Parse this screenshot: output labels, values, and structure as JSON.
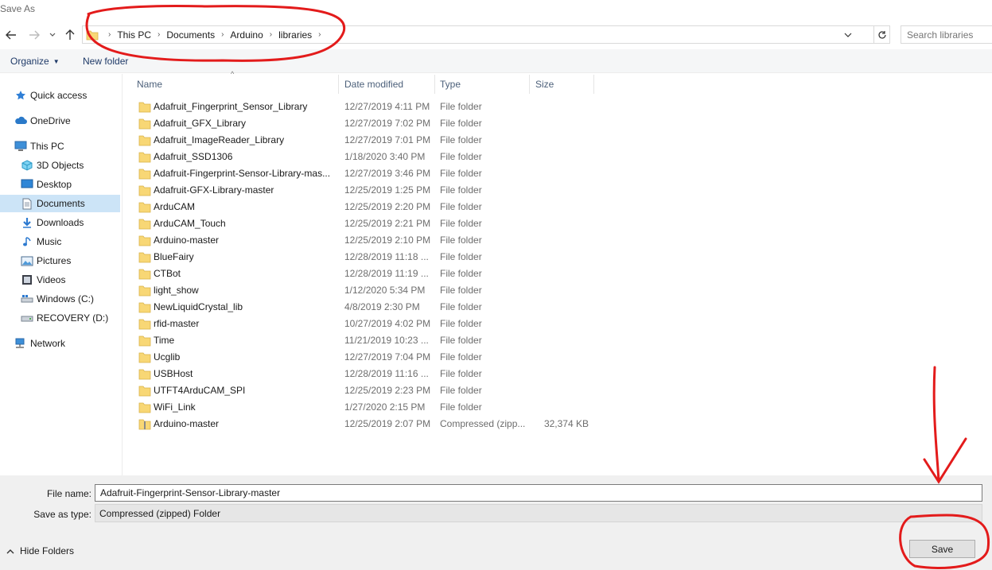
{
  "window": {
    "title": "Save As"
  },
  "address": {
    "breadcrumbs": [
      "This PC",
      "Documents",
      "Arduino",
      "libraries"
    ],
    "search_placeholder": "Search libraries"
  },
  "commands": {
    "organize": "Organize",
    "new_folder": "New folder"
  },
  "nav": {
    "items": [
      {
        "label": "Quick access",
        "icon": "star-icon"
      },
      {
        "label": "OneDrive",
        "icon": "cloud-icon"
      },
      {
        "label": "This PC",
        "icon": "computer-icon"
      },
      {
        "label": "3D Objects",
        "icon": "cube-icon"
      },
      {
        "label": "Desktop",
        "icon": "desktop-icon"
      },
      {
        "label": "Documents",
        "icon": "document-icon",
        "selected": true
      },
      {
        "label": "Downloads",
        "icon": "download-icon"
      },
      {
        "label": "Music",
        "icon": "music-icon"
      },
      {
        "label": "Pictures",
        "icon": "pictures-icon"
      },
      {
        "label": "Videos",
        "icon": "video-icon"
      },
      {
        "label": "Windows (C:)",
        "icon": "drive-icon"
      },
      {
        "label": "RECOVERY (D:)",
        "icon": "drive-icon"
      },
      {
        "label": "Network",
        "icon": "network-icon"
      }
    ]
  },
  "columns": {
    "name": "Name",
    "date": "Date modified",
    "type": "Type",
    "size": "Size"
  },
  "files": [
    {
      "name": "Adafruit_Fingerprint_Sensor_Library",
      "date": "12/27/2019 4:11 PM",
      "type": "File folder",
      "size": ""
    },
    {
      "name": "Adafruit_GFX_Library",
      "date": "12/27/2019 7:02 PM",
      "type": "File folder",
      "size": ""
    },
    {
      "name": "Adafruit_ImageReader_Library",
      "date": "12/27/2019 7:01 PM",
      "type": "File folder",
      "size": ""
    },
    {
      "name": "Adafruit_SSD1306",
      "date": "1/18/2020 3:40 PM",
      "type": "File folder",
      "size": ""
    },
    {
      "name": "Adafruit-Fingerprint-Sensor-Library-mas...",
      "date": "12/27/2019 3:46 PM",
      "type": "File folder",
      "size": ""
    },
    {
      "name": "Adafruit-GFX-Library-master",
      "date": "12/25/2019 1:25 PM",
      "type": "File folder",
      "size": ""
    },
    {
      "name": "ArduCAM",
      "date": "12/25/2019 2:20 PM",
      "type": "File folder",
      "size": ""
    },
    {
      "name": "ArduCAM_Touch",
      "date": "12/25/2019 2:21 PM",
      "type": "File folder",
      "size": ""
    },
    {
      "name": "Arduino-master",
      "date": "12/25/2019 2:10 PM",
      "type": "File folder",
      "size": ""
    },
    {
      "name": "BlueFairy",
      "date": "12/28/2019 11:18 ...",
      "type": "File folder",
      "size": ""
    },
    {
      "name": "CTBot",
      "date": "12/28/2019 11:19 ...",
      "type": "File folder",
      "size": ""
    },
    {
      "name": "light_show",
      "date": "1/12/2020 5:34 PM",
      "type": "File folder",
      "size": ""
    },
    {
      "name": "NewLiquidCrystal_lib",
      "date": "4/8/2019 2:30 PM",
      "type": "File folder",
      "size": ""
    },
    {
      "name": "rfid-master",
      "date": "10/27/2019 4:02 PM",
      "type": "File folder",
      "size": ""
    },
    {
      "name": "Time",
      "date": "11/21/2019 10:23 ...",
      "type": "File folder",
      "size": ""
    },
    {
      "name": "Ucglib",
      "date": "12/27/2019 7:04 PM",
      "type": "File folder",
      "size": ""
    },
    {
      "name": "USBHost",
      "date": "12/28/2019 11:16 ...",
      "type": "File folder",
      "size": ""
    },
    {
      "name": "UTFT4ArduCAM_SPI",
      "date": "12/25/2019 2:23 PM",
      "type": "File folder",
      "size": ""
    },
    {
      "name": "WiFi_Link",
      "date": "1/27/2020 2:15 PM",
      "type": "File folder",
      "size": ""
    },
    {
      "name": "Arduino-master",
      "date": "12/25/2019 2:07 PM",
      "type": "Compressed (zipp...",
      "size": "32,374 KB",
      "zip": true
    }
  ],
  "form": {
    "file_name_label": "File name:",
    "file_name_value": "Adafruit-Fingerprint-Sensor-Library-master",
    "save_type_label": "Save as type:",
    "save_type_value": "Compressed (zipped) Folder"
  },
  "footer": {
    "hide_folders": "Hide Folders",
    "save": "Save"
  },
  "colors": {
    "annotation": "#e31b1b",
    "selection": "#cce4f7",
    "folder": "#f8d775"
  }
}
